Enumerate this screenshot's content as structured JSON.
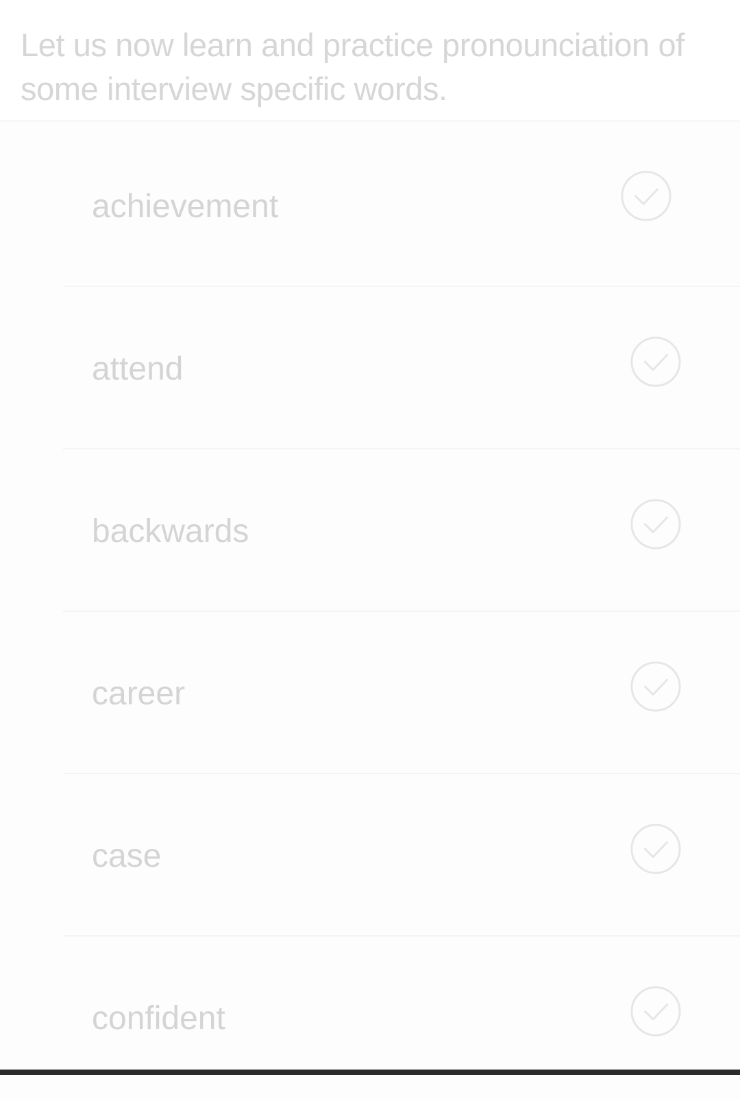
{
  "intro": {
    "text": "Let us now learn and practice pronounciation of some interview specific words."
  },
  "words": [
    {
      "label": "achievement",
      "icon": "check-circle-icon"
    },
    {
      "label": "attend",
      "icon": "check-circle-icon"
    },
    {
      "label": "backwards",
      "icon": "check-circle-icon"
    },
    {
      "label": "career",
      "icon": "check-circle-icon"
    },
    {
      "label": "case",
      "icon": "check-circle-icon"
    },
    {
      "label": "confident",
      "icon": "check-circle-icon"
    }
  ],
  "colors": {
    "background": "#fdfdfd",
    "text": "#d4d4d4",
    "icon": "#e6e6e6",
    "divider": "#f4f4f4",
    "bottom_bar": "#2b2b2b"
  }
}
